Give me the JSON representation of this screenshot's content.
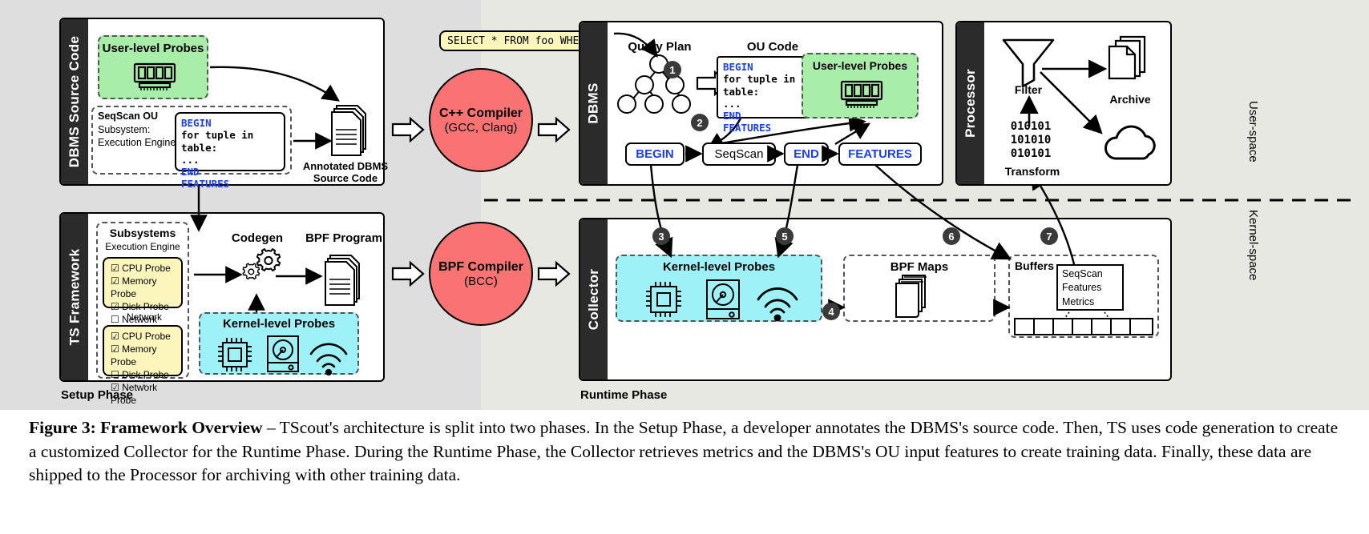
{
  "figure": {
    "caption_bold": "Figure 3: Framework Overview",
    "caption_rest": " – TScout's architecture is split into two phases. In the Setup Phase, a developer annotates the DBMS's source code. Then, TS uses code generation to create a customized Collector for the Runtime Phase. During the Runtime Phase, the Collector retrieves metrics and the DBMS's OU input features to create training data. Finally, these data are shipped to the Processor for archiving with other training data."
  },
  "phases": {
    "setup": "Setup Phase",
    "runtime": "Runtime Phase"
  },
  "spaces": {
    "user": "User-space",
    "kernel": "Kernel-space"
  },
  "setup": {
    "dbms_source": {
      "rail_label": "DBMS Source Code",
      "user_probes_title": "User-level Probes",
      "ou_name": "SeqScan OU",
      "ou_sub_label": "Subsystem:",
      "ou_sub_value": "Execution Engine",
      "code_lines": [
        "BEGIN",
        "for tuple in table:",
        "    ...",
        "END",
        "FEATURES"
      ],
      "annotated_label_1": "Annotated DBMS",
      "annotated_label_2": "Source Code"
    },
    "ts_framework": {
      "rail_label": "TS Framework",
      "subsystems_title": "Subsystems",
      "group1_name": "Execution Engine",
      "group1_probes": [
        {
          "label": "CPU Probe",
          "checked": true
        },
        {
          "label": "Memory Probe",
          "checked": true
        },
        {
          "label": "Disk Probe",
          "checked": true
        },
        {
          "label": "Network Probe",
          "checked": false
        }
      ],
      "group2_name": "Network",
      "group2_probes": [
        {
          "label": "CPU Probe",
          "checked": true
        },
        {
          "label": "Memory Probe",
          "checked": true
        },
        {
          "label": "Disk Probe",
          "checked": false
        },
        {
          "label": "Network Probe",
          "checked": true
        }
      ],
      "ellipsis": "⋮",
      "codegen_label": "Codegen",
      "bpf_program_label": "BPF Program",
      "kernel_probes_title": "Kernel-level Probes"
    }
  },
  "compilers": [
    {
      "name": "C++ Compiler",
      "detail": "(GCC, Clang)",
      "color": "#fa7373"
    },
    {
      "name": "BPF Compiler",
      "detail": "(BCC)",
      "color": "#fa7373"
    }
  ],
  "runtime": {
    "dbms": {
      "rail_label": "DBMS",
      "sql_query": "SELECT * FROM foo WHERE …",
      "query_plan_label": "Query Plan",
      "ou_code_label": "OU Code",
      "ou_code_lines": [
        "BEGIN",
        "for tuple in table:",
        "    ...",
        "END",
        "FEATURES"
      ],
      "user_probes_title": "User-level Probes",
      "pipeline": [
        "BEGIN",
        "SeqScan",
        "END",
        "FEATURES"
      ],
      "markers": [
        "1",
        "2"
      ]
    },
    "collector": {
      "rail_label": "Collector",
      "kernel_probes_title": "Kernel-level Probes",
      "bpf_maps_title": "BPF Maps",
      "buffers_title": "Buffers",
      "buffer_items": [
        "SeqScan",
        "Features",
        "Metrics"
      ],
      "markers": [
        "3",
        "4",
        "5",
        "6",
        "7"
      ]
    },
    "processor": {
      "rail_label": "Processor",
      "filter_label": "Filter",
      "transform_label": "Transform",
      "binary_lines": [
        "010101",
        "101010",
        "010101"
      ],
      "archive_label": "Archive"
    }
  },
  "icons": {
    "memory_chip": "memory-chip-icon",
    "cpu": "cpu-chip-icon",
    "disk": "hard-disk-icon",
    "wifi": "wifi-icon",
    "gears": "gears-icon",
    "documents": "document-stack-icon",
    "funnel": "funnel-filter-icon",
    "cloud": "cloud-icon",
    "tree": "query-tree-icon",
    "block_arrow": "block-arrow-icon"
  },
  "palette": {
    "green_probe": "#a8eda8",
    "cyan_probe": "#9ef2f7",
    "yellow_box": "#fcf6bd",
    "compiler_red": "#fa7373",
    "rail_dark": "#2b2b2b",
    "bg": "#e8e8e2"
  }
}
